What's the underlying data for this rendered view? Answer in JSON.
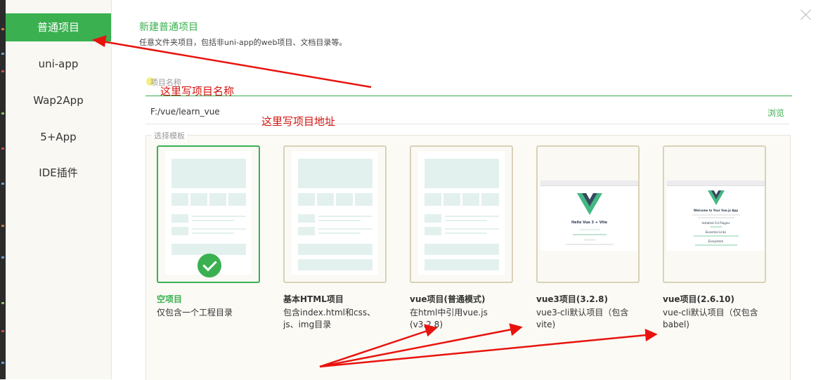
{
  "sidebar": {
    "items": [
      {
        "label": "普通项目",
        "active": true
      },
      {
        "label": "uni-app",
        "active": false
      },
      {
        "label": "Wap2App",
        "active": false
      },
      {
        "label": "5+App",
        "active": false
      },
      {
        "label": "IDE插件",
        "active": false
      }
    ]
  },
  "header": {
    "title": "新建普通项目",
    "description": "任意文件夹项目，包括非uni-app的web项目、文档目录等。"
  },
  "form": {
    "name_placeholder": "项目名称",
    "path_value": "F:/vue/learn_vue",
    "browse_label": "浏览",
    "template_legend": "选择模板"
  },
  "templates": [
    {
      "title": "空项目",
      "desc": "仅包含一个工程目录",
      "selected": true
    },
    {
      "title": "基本HTML项目",
      "desc": "包含index.html和css、js、img目录",
      "selected": false
    },
    {
      "title": "vue项目(普通模式)",
      "desc": "在html中引用vue.js (v3.2.8)",
      "selected": false
    },
    {
      "title": "vue3项目(3.2.8)",
      "desc": "vue3-cli默认项目（包含vite)",
      "selected": false
    },
    {
      "title": "vue项目(2.6.10)",
      "desc": "vue-cli默认项目（仅包含babel)",
      "selected": false
    }
  ],
  "previews": {
    "vite_heading": "Hello Vue 3 + Vite",
    "vue2_heading": "Welcome to Your Vue.js App",
    "vue2_plugins": "Installed CLI Plugins",
    "vue2_links": "Essential Links",
    "vue2_ecosystem": "Ecosystem"
  },
  "annotations": {
    "name_note": "这里写项目名称",
    "path_note": "这里写项目地址"
  },
  "colors": {
    "accent": "#3ab050",
    "annotation": "#d4140f",
    "vue_green": "#42b883",
    "vue_dark": "#35495e"
  },
  "icons": {
    "close": "close-icon",
    "check": "check-icon",
    "vue_logo": "vue-logo-icon"
  }
}
